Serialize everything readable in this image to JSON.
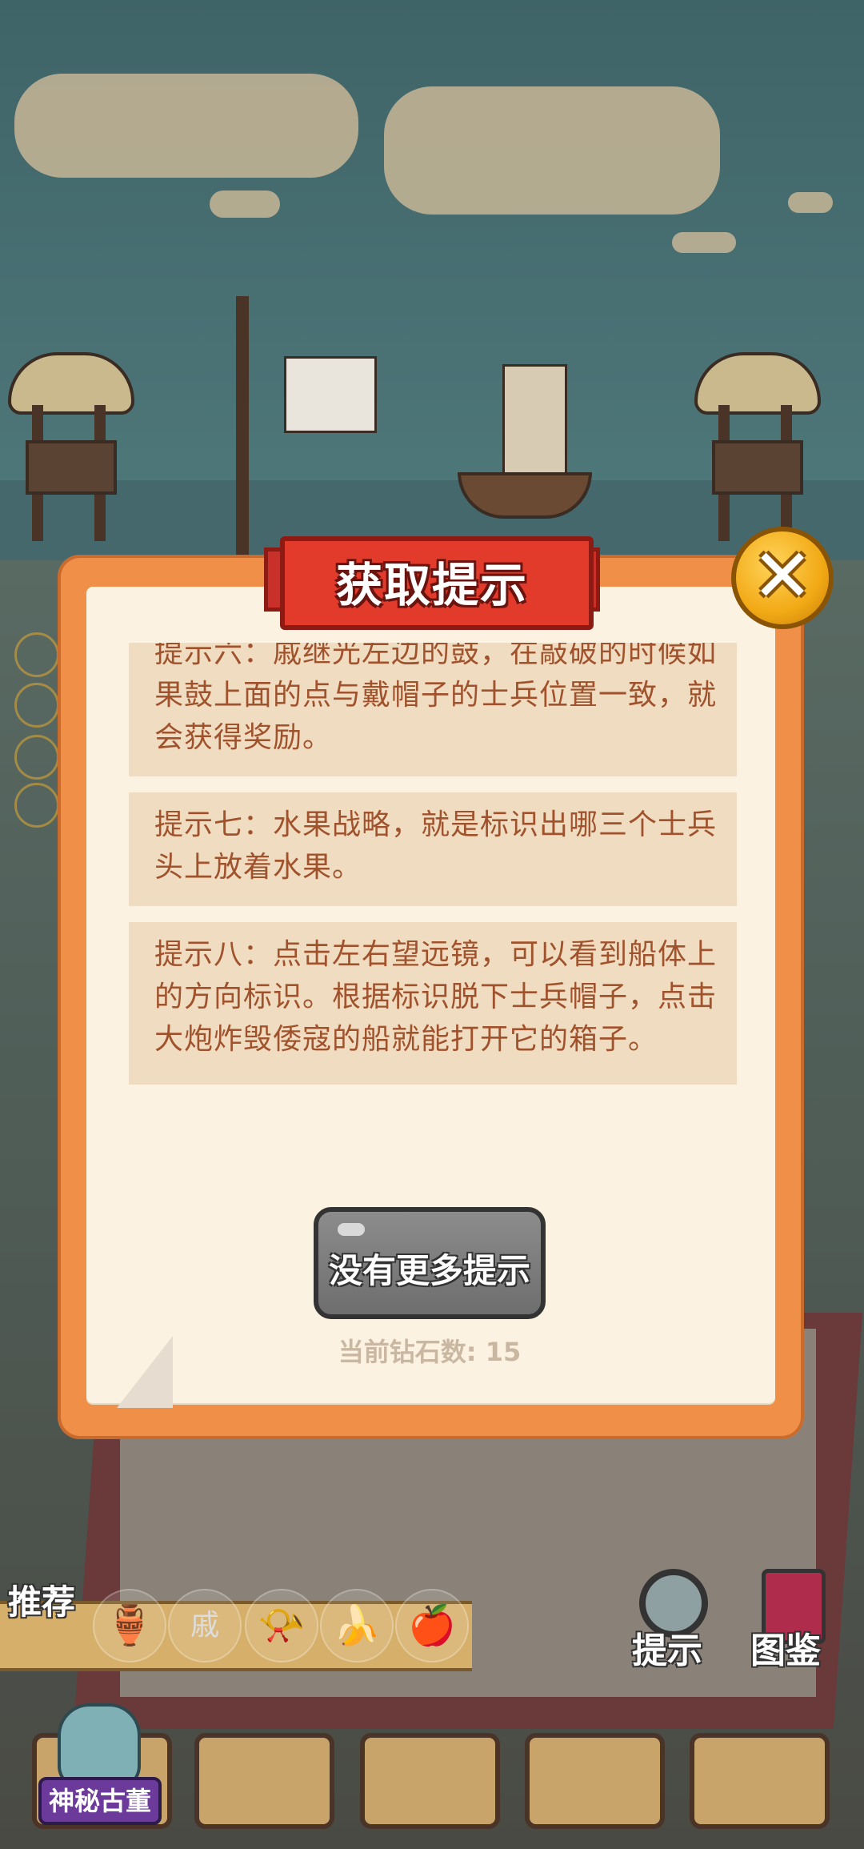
{
  "modal": {
    "title": "获取提示",
    "close_label": "✕",
    "hints": [
      "提示六：戚继光左边的鼓，在敲破的时候如果鼓上面的点与戴帽子的士兵位置一致，就会获得奖励。",
      "提示七：水果战略，就是标识出哪三个士兵头上放着水果。",
      "提示八：点击左右望远镜，可以看到船体上的方向标识。根据标识脱下士兵帽子，点击大炮炸毁倭寇的船就能打开它的箱子。"
    ],
    "more_button_label": "没有更多提示",
    "diamond_count_label": "当前钻石数: 15"
  },
  "hud": {
    "recommend_label": "推荐",
    "recommend_items": [
      {
        "icon": "gourd-icon",
        "glyph": "🏺"
      },
      {
        "icon": "banner-flag-icon",
        "glyph": "戚"
      },
      {
        "icon": "horn-icon",
        "glyph": "📯"
      },
      {
        "icon": "banana-icon",
        "glyph": "🍌"
      },
      {
        "icon": "apple-icon",
        "glyph": "🍎"
      }
    ],
    "hint_button_label": "提示",
    "catalog_button_label": "图鉴",
    "mystery_label": "神秘古董"
  },
  "colors": {
    "modal_frame": "#f08f47",
    "paper": "#fbf2e1",
    "hint_card": "#f0dcc0",
    "hint_text": "#a0522d",
    "banner": "#e23b2b",
    "close_button": "#f2a915",
    "disabled_button": "#7a7a7a"
  }
}
